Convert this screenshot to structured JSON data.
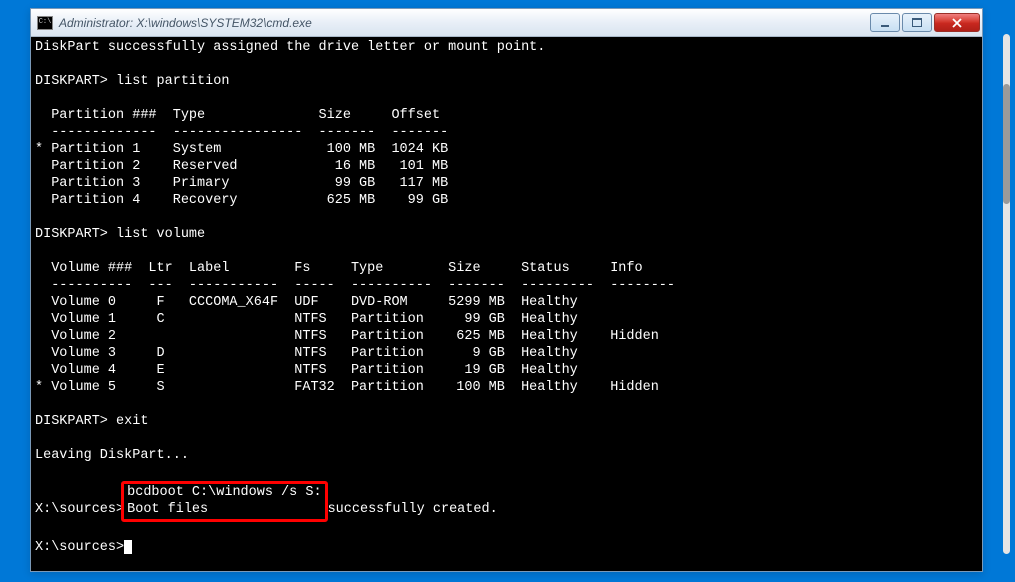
{
  "window": {
    "title": "Administrator: X:\\windows\\SYSTEM32\\cmd.exe"
  },
  "terminal": {
    "line_success": "DiskPart successfully assigned the drive letter or mount point.",
    "prompt1": "DISKPART> ",
    "cmd_list_partition": "list partition",
    "part_header": "  Partition ###  Type              Size     Offset",
    "part_divider": "  -------------  ----------------  -------  -------",
    "part_row1": "* Partition 1    System             100 MB  1024 KB",
    "part_row2": "  Partition 2    Reserved            16 MB   101 MB",
    "part_row3": "  Partition 3    Primary             99 GB   117 MB",
    "part_row4": "  Partition 4    Recovery           625 MB    99 GB",
    "prompt2": "DISKPART> ",
    "cmd_list_volume": "list volume",
    "vol_header": "  Volume ###  Ltr  Label        Fs     Type        Size     Status     Info",
    "vol_divider": "  ----------  ---  -----------  -----  ----------  -------  ---------  --------",
    "vol_row1": "  Volume 0     F   CCCOMA_X64F  UDF    DVD-ROM     5299 MB  Healthy",
    "vol_row2": "  Volume 1     C                NTFS   Partition     99 GB  Healthy",
    "vol_row3": "  Volume 2                      NTFS   Partition    625 MB  Healthy    Hidden",
    "vol_row4": "  Volume 3     D                NTFS   Partition      9 GB  Healthy",
    "vol_row5": "  Volume 4     E                NTFS   Partition     19 GB  Healthy",
    "vol_row6": "* Volume 5     S                FAT32  Partition    100 MB  Healthy    Hidden",
    "prompt3": "DISKPART> ",
    "cmd_exit": "exit",
    "leaving": "Leaving DiskPart...",
    "prompt_src1": "X:\\sources>",
    "cmd_bcdboot": "bcdboot C:\\windows /s S:",
    "boot_prefix": "Boot files ",
    "boot_suffix": "successfully created.",
    "prompt_src2": "X:\\sources>"
  },
  "partitions": [
    {
      "num": 1,
      "type": "System",
      "size": "100 MB",
      "offset": "1024 KB",
      "selected": true
    },
    {
      "num": 2,
      "type": "Reserved",
      "size": "16 MB",
      "offset": "101 MB",
      "selected": false
    },
    {
      "num": 3,
      "type": "Primary",
      "size": "99 GB",
      "offset": "117 MB",
      "selected": false
    },
    {
      "num": 4,
      "type": "Recovery",
      "size": "625 MB",
      "offset": "99 GB",
      "selected": false
    }
  ],
  "volumes": [
    {
      "num": 0,
      "ltr": "F",
      "label": "CCCOMA_X64F",
      "fs": "UDF",
      "type": "DVD-ROM",
      "size": "5299 MB",
      "status": "Healthy",
      "info": "",
      "selected": false
    },
    {
      "num": 1,
      "ltr": "C",
      "label": "",
      "fs": "NTFS",
      "type": "Partition",
      "size": "99 GB",
      "status": "Healthy",
      "info": "",
      "selected": false
    },
    {
      "num": 2,
      "ltr": "",
      "label": "",
      "fs": "NTFS",
      "type": "Partition",
      "size": "625 MB",
      "status": "Healthy",
      "info": "Hidden",
      "selected": false
    },
    {
      "num": 3,
      "ltr": "D",
      "label": "",
      "fs": "NTFS",
      "type": "Partition",
      "size": "9 GB",
      "status": "Healthy",
      "info": "",
      "selected": false
    },
    {
      "num": 4,
      "ltr": "E",
      "label": "",
      "fs": "NTFS",
      "type": "Partition",
      "size": "19 GB",
      "status": "Healthy",
      "info": "",
      "selected": false
    },
    {
      "num": 5,
      "ltr": "S",
      "label": "",
      "fs": "FAT32",
      "type": "Partition",
      "size": "100 MB",
      "status": "Healthy",
      "info": "Hidden",
      "selected": true
    }
  ]
}
